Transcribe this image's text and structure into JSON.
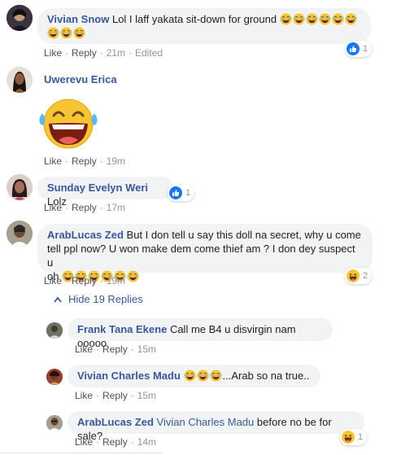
{
  "comments": [
    {
      "name": "Vivian Snow",
      "text": "Lol I laff yakata sit-down for ground",
      "line1_emoji": 6,
      "line2_emoji": 3,
      "like": "Like",
      "reply": "Reply",
      "time": "21m",
      "edited": "Edited",
      "reaction_count": "1",
      "reaction_icon": "like-icon"
    },
    {
      "name": "Uwerevu Erica",
      "sticker": "laughing-sticker",
      "like": "Like",
      "reply": "Reply",
      "time": "19m"
    },
    {
      "name": "Sunday Evelyn Weri",
      "text": "Lolz",
      "like": "Like",
      "reply": "Reply",
      "time": "17m",
      "reaction_count": "1",
      "reaction_icon": "like-icon"
    },
    {
      "name": "ArabLucas Zed",
      "line1": "But I don tell u say this doll na secret, why u come",
      "line2": "tell ppl now? U won make dem come thief am ? I don dey suspect u",
      "line3": "oh",
      "line3_emoji": 6,
      "like": "Like",
      "reply": "Reply",
      "time": "19m",
      "reaction_count": "2",
      "reaction_icon": "haha-icon"
    }
  ],
  "hide_replies": "Hide 19 Replies",
  "replies": [
    {
      "name": "Frank Tana Ekene",
      "text": "Call me B4 u disvirgin nam ooooo",
      "like": "Like",
      "reply": "Reply",
      "time": "15m"
    },
    {
      "name": "Vivian Charles Madu",
      "emoji_count": 3,
      "text": "...Arab so na true..",
      "like": "Like",
      "reply": "Reply",
      "time": "15m"
    },
    {
      "name": "ArabLucas Zed",
      "mention": "Vivian Charles Madu",
      "text": "before no be for sale?",
      "like": "Like",
      "reply": "Reply",
      "time": "14m",
      "reaction_count": "1",
      "reaction_icon": "haha-icon"
    }
  ],
  "colors": {
    "name_link": "#385898",
    "bubble_bg": "#f2f3f5",
    "meta_text": "#90949c",
    "like_blue": "#1877f2",
    "emoji_yellow": "#f7c533"
  }
}
